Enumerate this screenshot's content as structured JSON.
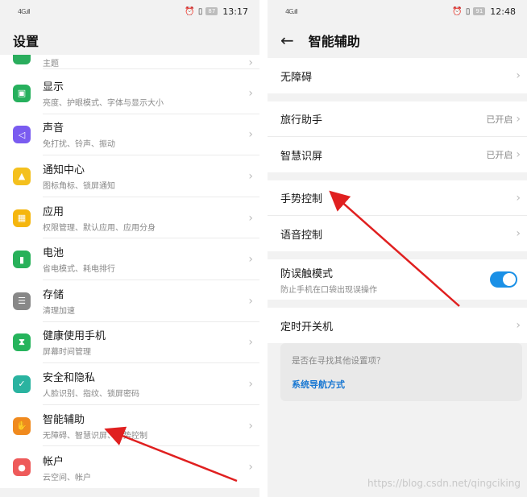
{
  "left": {
    "status": {
      "signal": "4G.ıll",
      "battery": "87",
      "time": "13:17"
    },
    "title": "设置",
    "items": [
      {
        "title": "",
        "sub": "主题",
        "icon": "theme-icon",
        "color": "#2aad5d",
        "glyph": "⛶"
      },
      {
        "title": "显示",
        "sub": "亮度、护眼模式、字体与显示大小",
        "icon": "display-icon",
        "color": "#27b05d",
        "glyph": "▣"
      },
      {
        "title": "声音",
        "sub": "免打扰、铃声、振动",
        "icon": "sound-icon",
        "color": "#7a5cf0",
        "glyph": "◁"
      },
      {
        "title": "通知中心",
        "sub": "图标角标、锁屏通知",
        "icon": "bell-icon",
        "color": "#f4c01e",
        "glyph": "▲"
      },
      {
        "title": "应用",
        "sub": "权限管理、默认应用、应用分身",
        "icon": "apps-icon",
        "color": "#f5b60e",
        "glyph": "▦"
      },
      {
        "title": "电池",
        "sub": "省电模式、耗电排行",
        "icon": "battery-icon",
        "color": "#28b15a",
        "glyph": "▮"
      },
      {
        "title": "存储",
        "sub": "清理加速",
        "icon": "storage-icon",
        "color": "#888888",
        "glyph": "☰"
      },
      {
        "title": "健康使用手机",
        "sub": "屏幕时间管理",
        "icon": "hourglass-icon",
        "color": "#26b45c",
        "glyph": "⧗"
      },
      {
        "title": "安全和隐私",
        "sub": "人脸识别、指纹、锁屏密码",
        "icon": "shield-icon",
        "color": "#2ab3a0",
        "glyph": "✓"
      },
      {
        "title": "智能辅助",
        "sub": "无障碍、智慧识屏、手势控制",
        "icon": "hand-icon",
        "color": "#f08a1e",
        "glyph": "✋"
      },
      {
        "title": "帐户",
        "sub": "云空间、帐户",
        "icon": "account-icon",
        "color": "#ee5a5a",
        "glyph": "●"
      }
    ]
  },
  "right": {
    "status": {
      "signal": "4G.ıll",
      "battery": "91",
      "time": "12:48"
    },
    "title": "智能辅助",
    "groups": [
      [
        {
          "label": "无障碍",
          "status": ""
        }
      ],
      [
        {
          "label": "旅行助手",
          "status": "已开启"
        },
        {
          "label": "智慧识屏",
          "status": "已开启"
        }
      ],
      [
        {
          "label": "手势控制",
          "status": ""
        },
        {
          "label": "语音控制",
          "status": ""
        }
      ],
      [
        {
          "label": "防误触模式",
          "sub": "防止手机在口袋出现误操作",
          "toggle": true
        }
      ],
      [
        {
          "label": "定时开关机",
          "status": ""
        }
      ]
    ],
    "suggest": {
      "question": "是否在寻找其他设置项？",
      "link": "系统导航方式"
    }
  },
  "colors": {
    "arrow": "#e02020",
    "toggle": "#1a90e6",
    "link": "#1877d2"
  },
  "watermark": "https://blog.csdn.net/qingciking"
}
